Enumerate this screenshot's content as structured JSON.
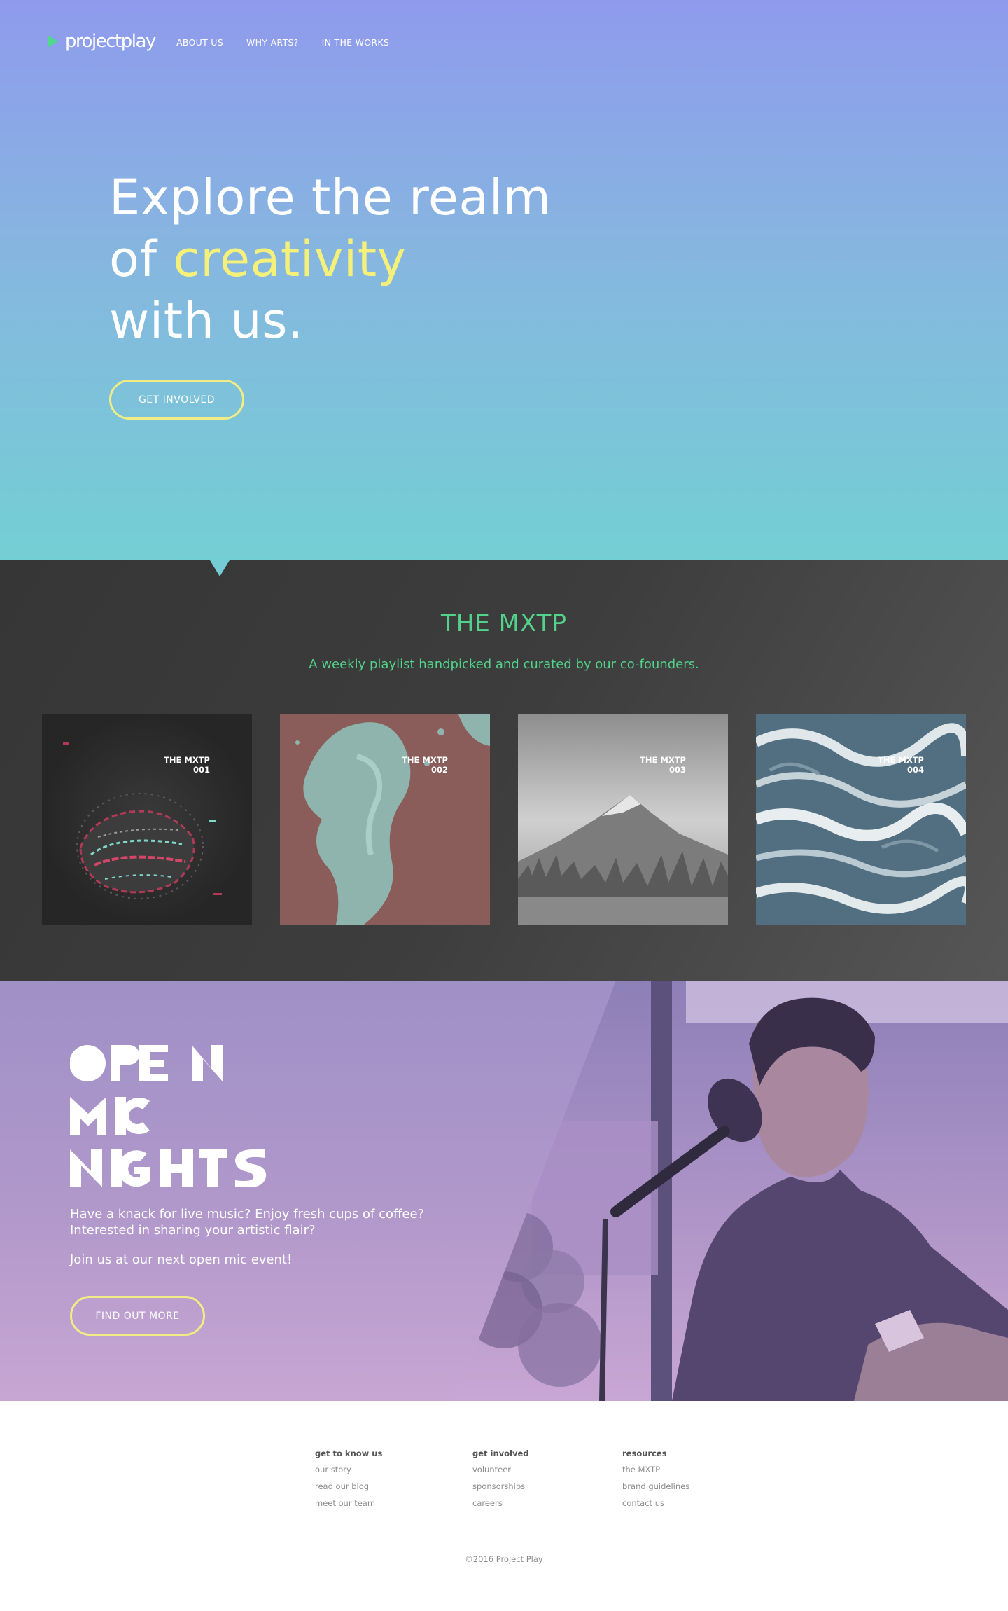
{
  "header": {
    "logo_text": "projectplay",
    "nav": [
      "ABOUT US",
      "WHY ARTS?",
      "IN THE WORKS"
    ]
  },
  "hero": {
    "line1": "Explore the realm",
    "line2_prefix": "of ",
    "line2_highlight": "creativity",
    "line3": "with us.",
    "cta": "GET INVOLVED",
    "highlight_color": "#f4f07a"
  },
  "mxtp": {
    "title": "THE MXTP",
    "subtitle": "A weekly playlist handpicked and curated by our co-founders.",
    "accent_color": "#52d28a",
    "covers": [
      {
        "label": "THE MXTP",
        "number": "001"
      },
      {
        "label": "THE MXTP",
        "number": "002"
      },
      {
        "label": "THE MXTP",
        "number": "003"
      },
      {
        "label": "THE MXTP",
        "number": "004"
      }
    ]
  },
  "open_mic": {
    "title_lines": [
      "OPEN",
      "MIC",
      "NIGHTS"
    ],
    "text_line1": "Have a knack for live music? Enjoy fresh cups of coffee?",
    "text_line2": "Interested in sharing your artistic flair?",
    "text_line3": "Join us at our next open mic event!",
    "cta": "FIND OUT MORE"
  },
  "footer": {
    "columns": [
      {
        "heading": "get to know us",
        "links": [
          "our story",
          "read our blog",
          "meet our team"
        ]
      },
      {
        "heading": "get involved",
        "links": [
          "volunteer",
          "sponsorships",
          "careers"
        ]
      },
      {
        "heading": "resources",
        "links": [
          "the MXTP",
          "brand guidelines",
          "contact us"
        ]
      }
    ],
    "copyright": "©2016 Project Play"
  }
}
